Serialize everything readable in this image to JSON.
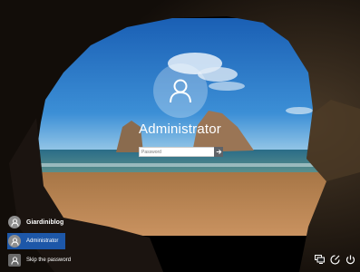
{
  "lock_screen": {
    "username": "Administrator",
    "password_placeholder": "Password",
    "submit_icon": "arrow-right-icon"
  },
  "accounts": [
    {
      "label": "Giardiniblog",
      "icon": "user-icon",
      "selected": false
    },
    {
      "label": "Administrator",
      "icon": "user-icon",
      "selected": true
    },
    {
      "label": "Skip the password",
      "icon": "user-icon",
      "selected": false
    }
  ],
  "system_tray": [
    "network-icon",
    "ease-of-access-icon",
    "power-icon"
  ],
  "colors": {
    "selected_account": "#1d57a8",
    "sky": "#1f6fc4",
    "sea": "#2d6f8a",
    "sand": "#c48b55",
    "cave": "#17110c"
  }
}
